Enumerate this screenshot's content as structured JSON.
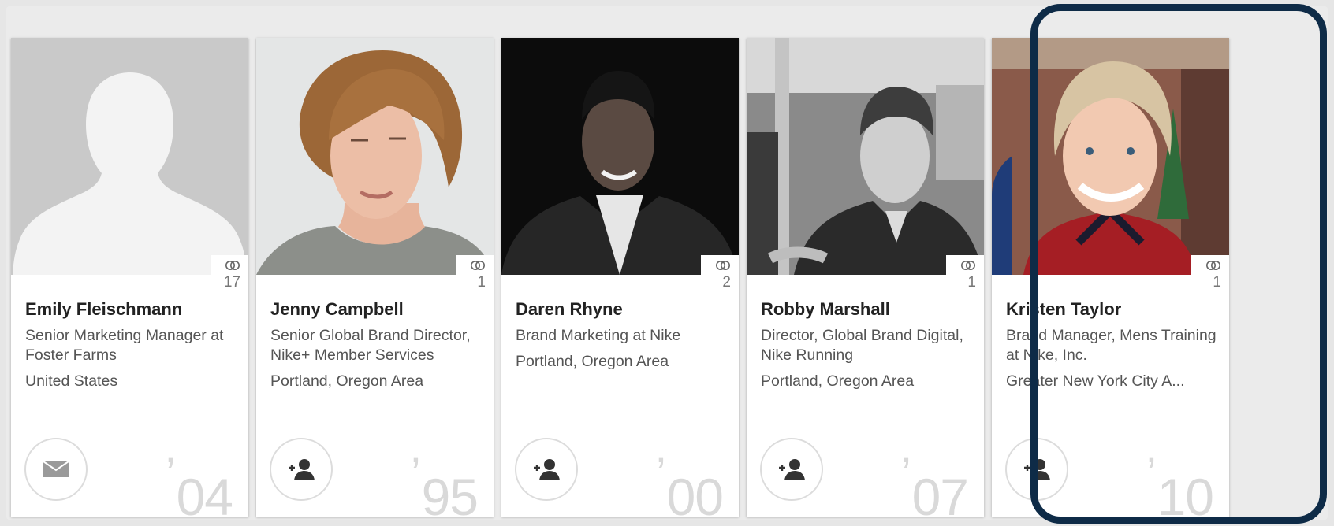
{
  "cards": [
    {
      "name": "Emily Fleischmann",
      "headline": "Senior Marketing Manager at Foster Farms",
      "location": "United States",
      "connections": "17",
      "year": "04",
      "action_icon": "mail-icon",
      "photo": "default-avatar-silhouette"
    },
    {
      "name": "Jenny Campbell",
      "headline": "Senior Global Brand Director, Nike+ Member Services",
      "location": "Portland, Oregon Area",
      "connections": "1",
      "year": "95",
      "action_icon": "add-connection-icon",
      "photo": "woman-with-auburn-bob"
    },
    {
      "name": "Daren Rhyne",
      "headline": "Brand Marketing at Nike",
      "location": "Portland, Oregon Area",
      "connections": "2",
      "year": "00",
      "action_icon": "add-connection-icon",
      "photo": "man-in-suit-black-and-white"
    },
    {
      "name": "Robby Marshall",
      "headline": "Director, Global Brand Digital, Nike Running",
      "location": "Portland, Oregon Area",
      "connections": "1",
      "year": "07",
      "action_icon": "add-connection-icon",
      "photo": "man-on-train-black-and-white"
    },
    {
      "name": "Kristen Taylor",
      "headline": "Brand Manager, Mens Training at Nike, Inc.",
      "location": "Greater New York City A...",
      "connections": "1",
      "year": "10",
      "action_icon": "add-connection-icon",
      "photo": "smiling-woman-plaid-collar"
    }
  ],
  "year_prefix": "’",
  "colors": {
    "highlight_border": "#0e2b47",
    "year_text": "#d9d9d9",
    "placeholder_bg": "#c8c8c8"
  }
}
